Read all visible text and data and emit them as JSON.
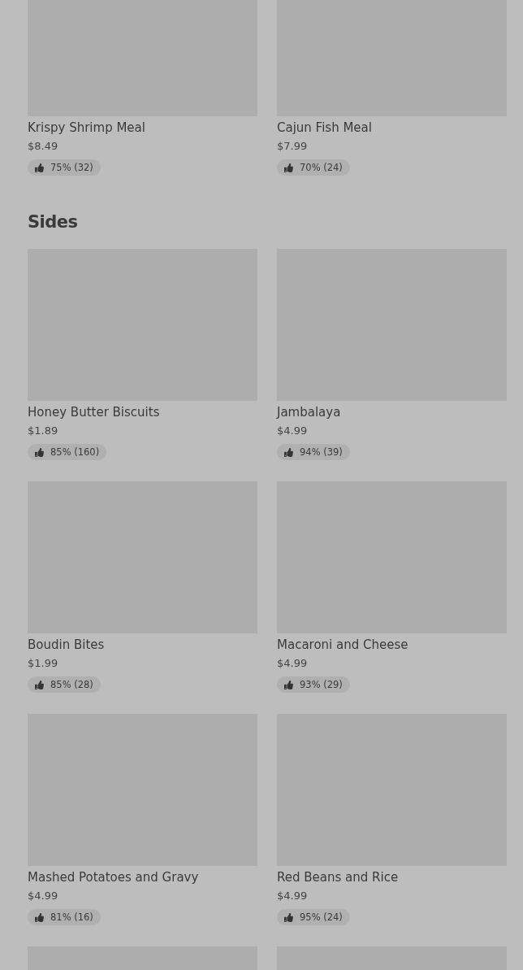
{
  "sections": [
    {
      "items": [
        {
          "kind": "item",
          "name": "Krispy Shrimp Meal",
          "price": "$8.49",
          "rating": "75% (32)"
        },
        {
          "kind": "item",
          "name": "Cajun Fish Meal",
          "price": "$7.99",
          "rating": "70% (24)"
        }
      ]
    },
    {
      "heading": "Sides",
      "items": [
        {
          "kind": "item",
          "name": "Honey Butter Biscuits",
          "price": "$1.89",
          "rating": "85% (160)"
        },
        {
          "kind": "item",
          "name": "Jambalaya",
          "price": "$4.99",
          "rating": "94% (39)"
        },
        {
          "kind": "item",
          "name": "Boudin Bites",
          "price": "$1.99",
          "rating": "85% (28)"
        },
        {
          "kind": "item",
          "name": "Macaroni and Cheese",
          "price": "$4.99",
          "rating": "93% (29)"
        },
        {
          "kind": "item",
          "name": "Mashed Potatoes and Gravy",
          "price": "$4.99",
          "rating": "81% (16)"
        },
        {
          "kind": "item",
          "name": "Red Beans and Rice",
          "price": "$4.99",
          "rating": "95% (24)"
        },
        {
          "kind": "cut"
        },
        {
          "kind": "cut"
        }
      ]
    }
  ]
}
